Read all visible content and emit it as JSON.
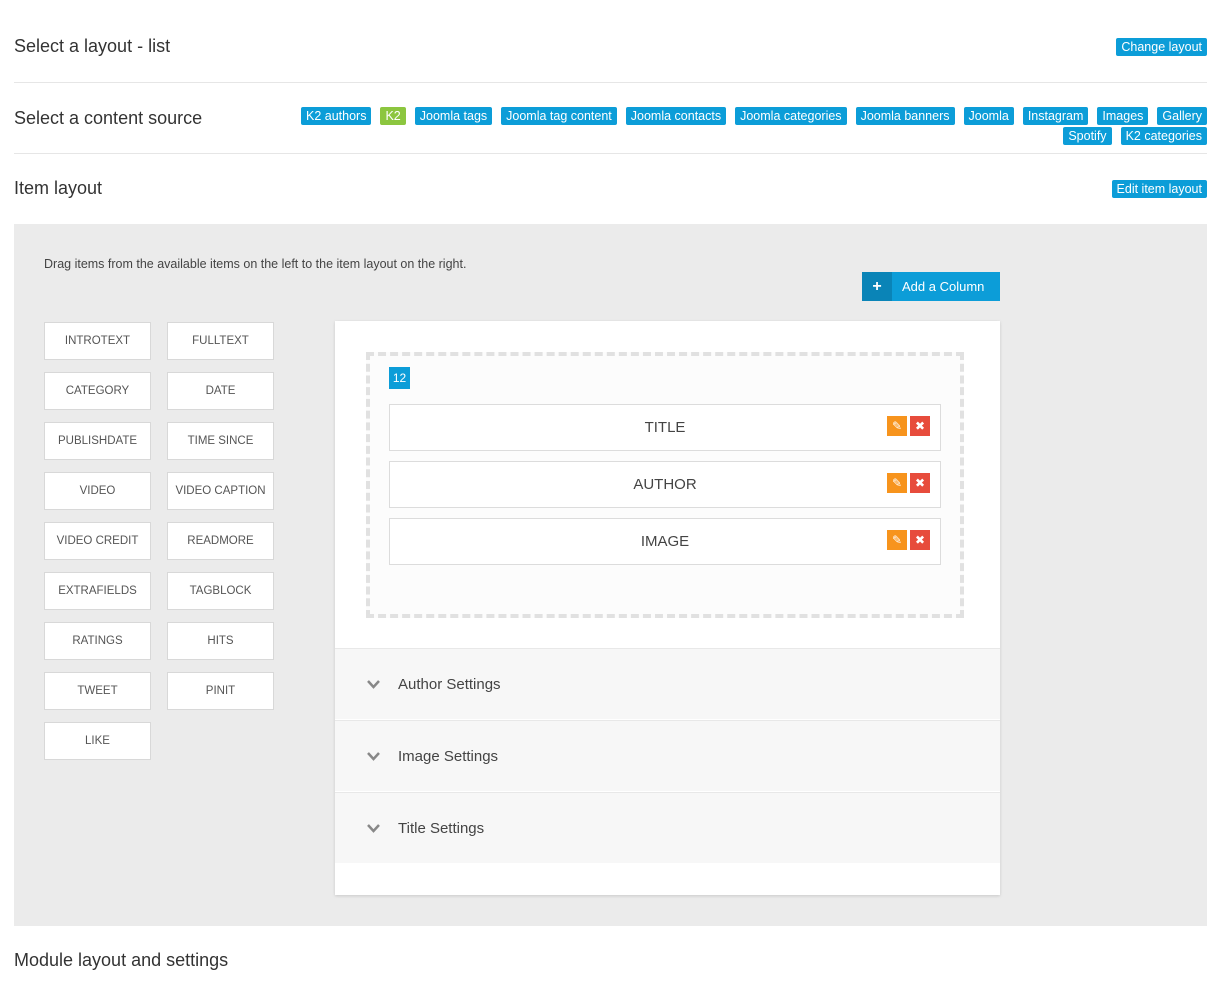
{
  "layout_section": {
    "title": "Select a layout - list",
    "button": "Change layout"
  },
  "content_source": {
    "title": "Select a content source",
    "sources": [
      {
        "label": "K2 authors",
        "color": "#0c9dd8"
      },
      {
        "label": "K2",
        "color": "#8cc63f"
      },
      {
        "label": "Joomla tags",
        "color": "#0c9dd8"
      },
      {
        "label": "Joomla tag content",
        "color": "#0c9dd8"
      },
      {
        "label": "Joomla contacts",
        "color": "#0c9dd8"
      },
      {
        "label": "Joomla categories",
        "color": "#0c9dd8"
      },
      {
        "label": "Joomla banners",
        "color": "#0c9dd8"
      },
      {
        "label": "Joomla",
        "color": "#0c9dd8"
      },
      {
        "label": "Instagram",
        "color": "#0c9dd8"
      },
      {
        "label": "Images",
        "color": "#0c9dd8"
      },
      {
        "label": "Gallery",
        "color": "#0c9dd8"
      },
      {
        "label": "Spotify",
        "color": "#0c9dd8"
      },
      {
        "label": "K2 categories",
        "color": "#0c9dd8"
      }
    ]
  },
  "item_layout": {
    "title": "Item layout",
    "button": "Edit item layout",
    "instructions": "Drag items from the available items on the left to the item layout on the right.",
    "add_column_label": "Add a Column",
    "add_column_icon": "plus-icon",
    "available_items": [
      "INTROTEXT",
      "FULLTEXT",
      "CATEGORY",
      "DATE",
      "PUBLISHDATE",
      "TIME SINCE",
      "VIDEO",
      "VIDEO CAPTION",
      "VIDEO CREDIT",
      "READMORE",
      "EXTRAFIELDS",
      "TAGBLOCK",
      "RATINGS",
      "HITS",
      "TWEET",
      "PINIT",
      "LIKE"
    ],
    "column": {
      "width_badge": "12",
      "items": [
        "TITLE",
        "AUTHOR",
        "IMAGE"
      ]
    },
    "settings": [
      "Author Settings",
      "Image Settings",
      "Title Settings"
    ]
  },
  "module_section": {
    "title": "Module layout and settings"
  },
  "colors": {
    "accent": "#0c9dd8",
    "green": "#8cc63f",
    "edit": "#f7941d",
    "delete": "#e74c3c"
  }
}
